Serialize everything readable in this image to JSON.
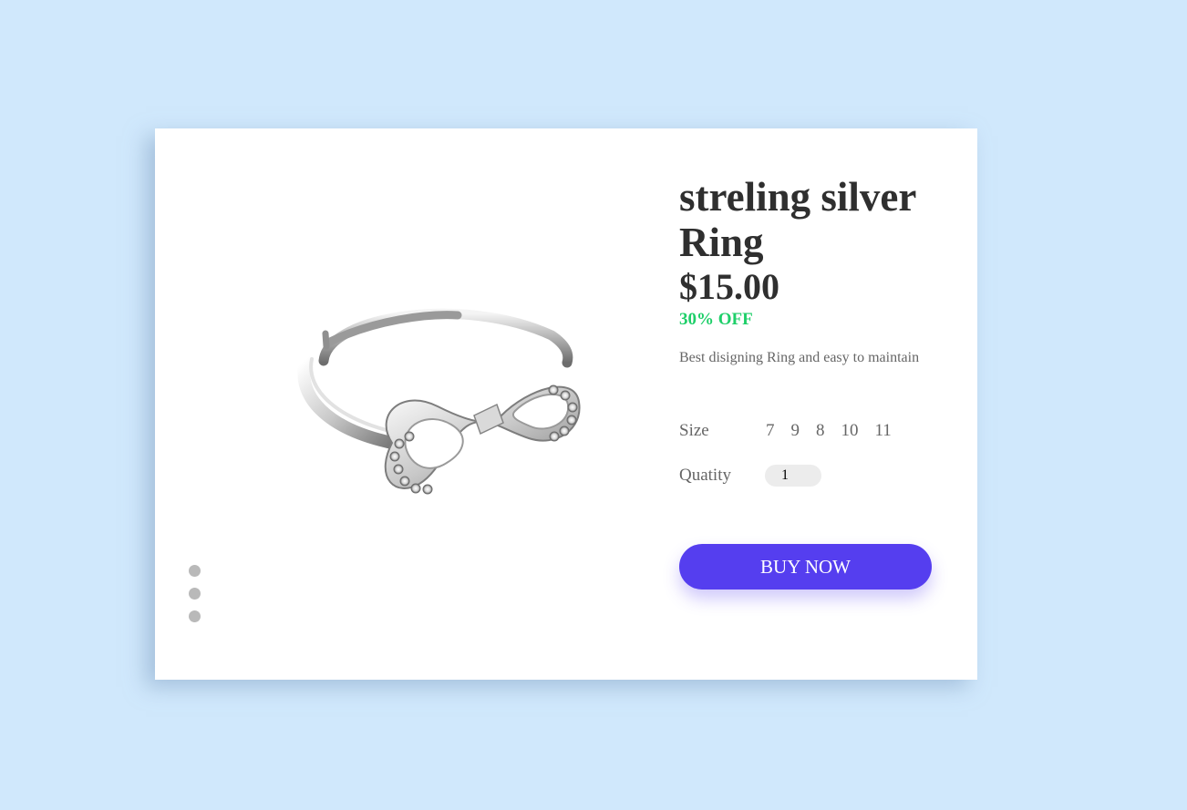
{
  "product": {
    "title": "streling silver Ring",
    "price": "$15.00",
    "discount": "30% OFF",
    "description": "Best disigning Ring and easy to maintain",
    "image_icon": "silver-infinity-ring"
  },
  "size": {
    "label": "Size",
    "options": [
      "7",
      "9",
      "8",
      "10",
      "11"
    ]
  },
  "quantity": {
    "label": "Quatity",
    "value": "1"
  },
  "buy_button": {
    "label": "BUY NOW"
  },
  "colors": {
    "page_background": "#d0e8fc",
    "card_background": "#ffffff",
    "accent": "#553eef",
    "discount": "#1ecf69",
    "dots": "#b9b9b9"
  },
  "carousel": {
    "dot_count": 3
  }
}
